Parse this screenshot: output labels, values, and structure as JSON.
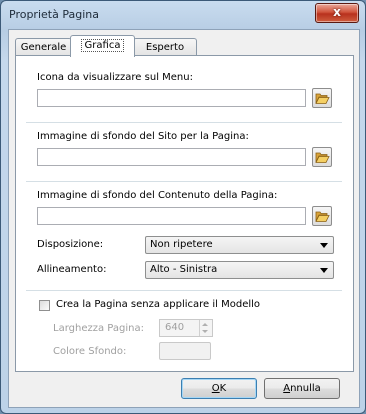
{
  "window": {
    "title": "Proprietà Pagina",
    "close_glyph": "x"
  },
  "tabs": [
    {
      "label": "Generale",
      "active": false
    },
    {
      "label": "Grafica",
      "active": true
    },
    {
      "label": "Esperto",
      "active": false
    }
  ],
  "grafica": {
    "menu_icon": {
      "label": "Icona da visualizzare sul Menu:",
      "value": "",
      "browse_icon": "folder-open-icon"
    },
    "site_background": {
      "label": "Immagine di sfondo del Sito per la Pagina:",
      "value": "",
      "browse_icon": "folder-open-icon"
    },
    "content_background": {
      "label": "Immagine di sfondo del Contenuto della Pagina:",
      "value": "",
      "browse_icon": "folder-open-icon"
    },
    "layout": {
      "label": "Disposizione:",
      "selected": "Non ripetere"
    },
    "alignment": {
      "label": "Allineamento:",
      "selected": "Alto - Sinistra"
    },
    "no_template": {
      "label": "Crea la Pagina senza applicare il Modello",
      "checked": false
    },
    "page_width": {
      "label": "Larghezza Pagina:",
      "value": "640"
    },
    "background_color": {
      "label": "Colore Sfondo:",
      "value": ""
    }
  },
  "buttons": {
    "ok": {
      "label_underlined": "O",
      "label_rest": "K"
    },
    "cancel": {
      "label_underlined": "A",
      "label_rest": "nnulla"
    }
  },
  "colors": {
    "accent": "#3c7fb1",
    "close": "#c7402a",
    "folder": "#e8b84a"
  }
}
